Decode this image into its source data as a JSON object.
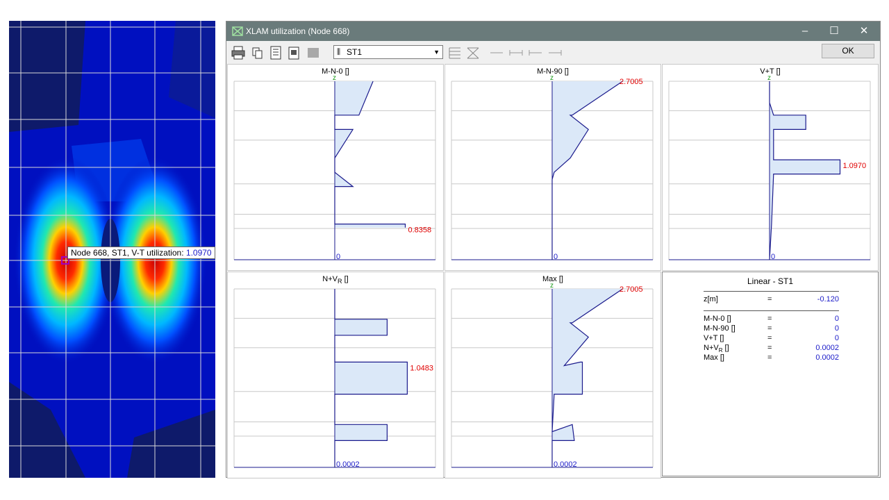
{
  "window": {
    "title": "XLAM utilization (Node 668)",
    "minimize": "–",
    "maximize": "☐",
    "close": "✕"
  },
  "toolbar": {
    "loadcase": "ST1",
    "ok_label": "OK"
  },
  "tooltip": {
    "text": "Node 668, ST1, V-T utilization:",
    "value": "1.0970"
  },
  "panels": [
    {
      "title": "M-N-0 []",
      "axis": "z",
      "max_label": "0.8358",
      "zero_label": "0",
      "points": [
        [
          0.19,
          0
        ],
        [
          0.12,
          0.19
        ],
        [
          0,
          0.19
        ],
        [
          0,
          0.27
        ],
        [
          0.09,
          0.27
        ],
        [
          0,
          0.43
        ],
        [
          0,
          0.51
        ],
        [
          0.09,
          0.59
        ],
        [
          0,
          0.59
        ],
        [
          0,
          0.8
        ],
        [
          0.35,
          0.8
        ],
        [
          0.35,
          0.82
        ]
      ]
    },
    {
      "title": "M-N-90 []",
      "axis": "z",
      "max_label": "2.7005",
      "zero_label": "0",
      "points": [
        [
          0.35,
          0
        ],
        [
          0.1,
          0.19
        ],
        [
          0.09,
          0.19
        ],
        [
          0.18,
          0.27
        ],
        [
          0.09,
          0.43
        ],
        [
          0.01,
          0.51
        ],
        [
          0,
          0.55
        ],
        [
          0,
          1
        ]
      ]
    },
    {
      "title": "V+T []",
      "axis": "z",
      "max_label": "1.0970",
      "zero_label": "0",
      "points": [
        [
          0,
          0
        ],
        [
          0,
          0.12
        ],
        [
          0.02,
          0.19
        ],
        [
          0.18,
          0.19
        ],
        [
          0.18,
          0.27
        ],
        [
          0.02,
          0.27
        ],
        [
          0.02,
          0.44
        ],
        [
          0.35,
          0.44
        ],
        [
          0.35,
          0.52
        ],
        [
          0.02,
          0.52
        ],
        [
          0.01,
          0.8
        ],
        [
          0,
          1
        ]
      ]
    },
    {
      "title": "N+V",
      "sub": "R",
      "title_suffix": " []",
      "axis": "",
      "max_label": "1.0483",
      "zero_label": "0.0002",
      "points": [
        [
          0,
          0
        ],
        [
          0,
          0.17
        ],
        [
          0.26,
          0.17
        ],
        [
          0.26,
          0.26
        ],
        [
          0,
          0.26
        ],
        [
          0,
          0.41
        ],
        [
          0.36,
          0.41
        ],
        [
          0.36,
          0.59
        ],
        [
          0,
          0.59
        ],
        [
          0,
          0.76
        ],
        [
          0.26,
          0.76
        ],
        [
          0.26,
          0.85
        ],
        [
          0,
          0.85
        ],
        [
          0,
          1
        ]
      ]
    },
    {
      "title": "Max []",
      "axis": "z",
      "max_label": "2.7005",
      "zero_label": "0.0002",
      "points": [
        [
          0.35,
          0
        ],
        [
          0.1,
          0.19
        ],
        [
          0.09,
          0.19
        ],
        [
          0.18,
          0.27
        ],
        [
          0.06,
          0.43
        ],
        [
          0.14,
          0.41
        ],
        [
          0.15,
          0.41
        ],
        [
          0.15,
          0.59
        ],
        [
          0.01,
          0.59
        ],
        [
          0,
          0.8
        ],
        [
          0.1,
          0.76
        ],
        [
          0.11,
          0.85
        ],
        [
          0,
          0.85
        ],
        [
          0,
          1
        ]
      ]
    }
  ],
  "summary": {
    "title": "Linear - ST1",
    "z_label": "z[m]",
    "eq": "=",
    "z_value": "-0.120",
    "rows": [
      {
        "label": "M-N-0 []",
        "value": "0"
      },
      {
        "label": "M-N-90 []",
        "value": "0"
      },
      {
        "label": "V+T []",
        "value": "0"
      },
      {
        "label": "N+V",
        "sub": "R",
        "suffix": " []",
        "value": "0.0002"
      },
      {
        "label": "Max []",
        "value": "0.0002"
      }
    ]
  },
  "colors": {
    "titlebar": "#6a7b7b",
    "curve": "#1a1a8c",
    "fill": "#dbe8f8",
    "max_label": "#e00000",
    "zero_label": "#1a1ac8",
    "axis_z": "#1a9a1a"
  }
}
